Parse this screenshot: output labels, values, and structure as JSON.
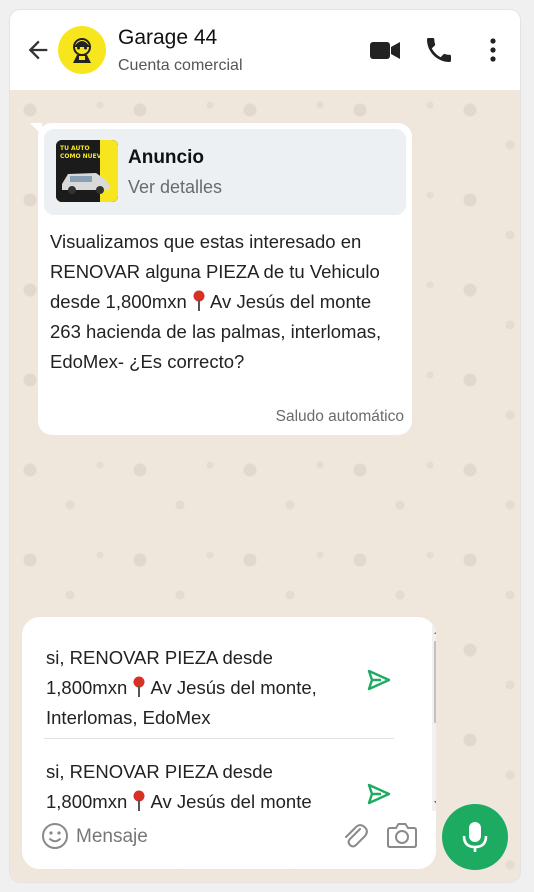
{
  "header": {
    "title": "Garage 44",
    "subtitle": "Cuenta comercial",
    "icons": [
      "back-arrow-icon",
      "video-call-icon",
      "phone-call-icon",
      "more-menu-icon"
    ]
  },
  "incoming_message": {
    "ad_card": {
      "title": "Anuncio",
      "subtitle": "Ver detalles",
      "thumbnail_text": "TU AUTO COMO NUEVO"
    },
    "text_before_pin": "Visualizamos que estas interesado en RENOVAR alguna PIEZA de tu Vehiculo desde 1,800mxn",
    "text_after_pin": " Av Jesús del monte 263 hacienda de las palmas, interlomas, EdoMex- ¿Es correcto?",
    "meta": "Saludo automático"
  },
  "suggestions": [
    {
      "text_before_pin": "si, RENOVAR PIEZA desde 1,800mxn",
      "text_after_pin": " Av Jesús del monte, Interlomas, EdoMex"
    },
    {
      "text_before_pin": "si, RENOVAR PIEZA desde 1,800mxn",
      "text_after_pin": " Av Jesús del monte"
    }
  ],
  "composer": {
    "placeholder": "Mensaje"
  },
  "colors": {
    "accent_green": "#1daa61",
    "pin_red": "#d93025",
    "avatar_yellow": "#f7e61e",
    "chat_background": "#efe7dc"
  }
}
